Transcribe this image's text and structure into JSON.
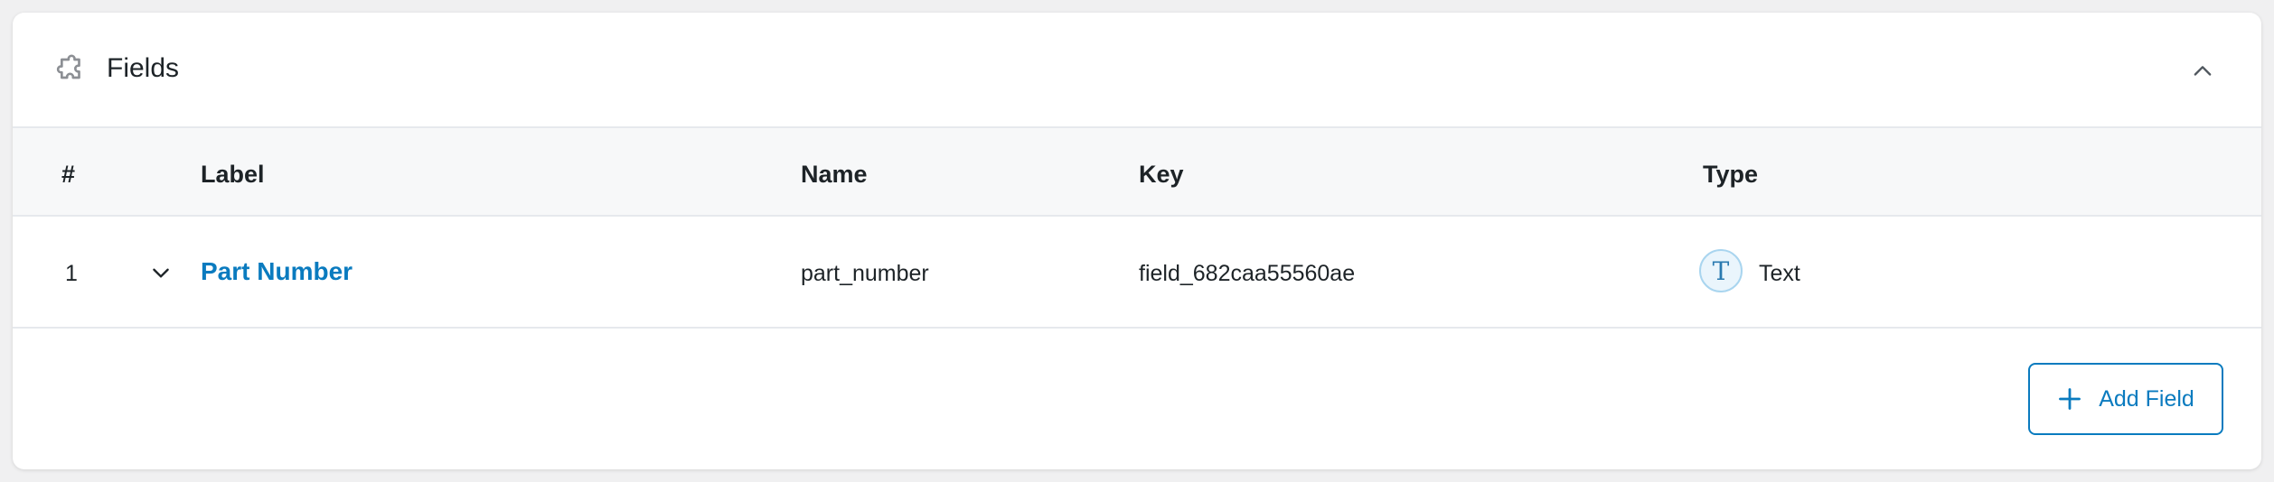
{
  "panel": {
    "title": "Fields",
    "icon": "puzzle-icon",
    "collapse_icon": "chevron-up-icon"
  },
  "table": {
    "headers": {
      "number": "#",
      "label": "Label",
      "name": "Name",
      "key": "Key",
      "type": "Type"
    },
    "rows": [
      {
        "number": "1",
        "label": "Part Number",
        "name": "part_number",
        "key": "field_682caa55560ae",
        "type": "Text",
        "type_icon_glyph": "T"
      }
    ]
  },
  "actions": {
    "add_field_label": "Add Field"
  },
  "colors": {
    "accent": "#0a7bbf",
    "text": "#1d2327",
    "header_bg": "#f7f8f9",
    "border": "#e6e9ed"
  }
}
